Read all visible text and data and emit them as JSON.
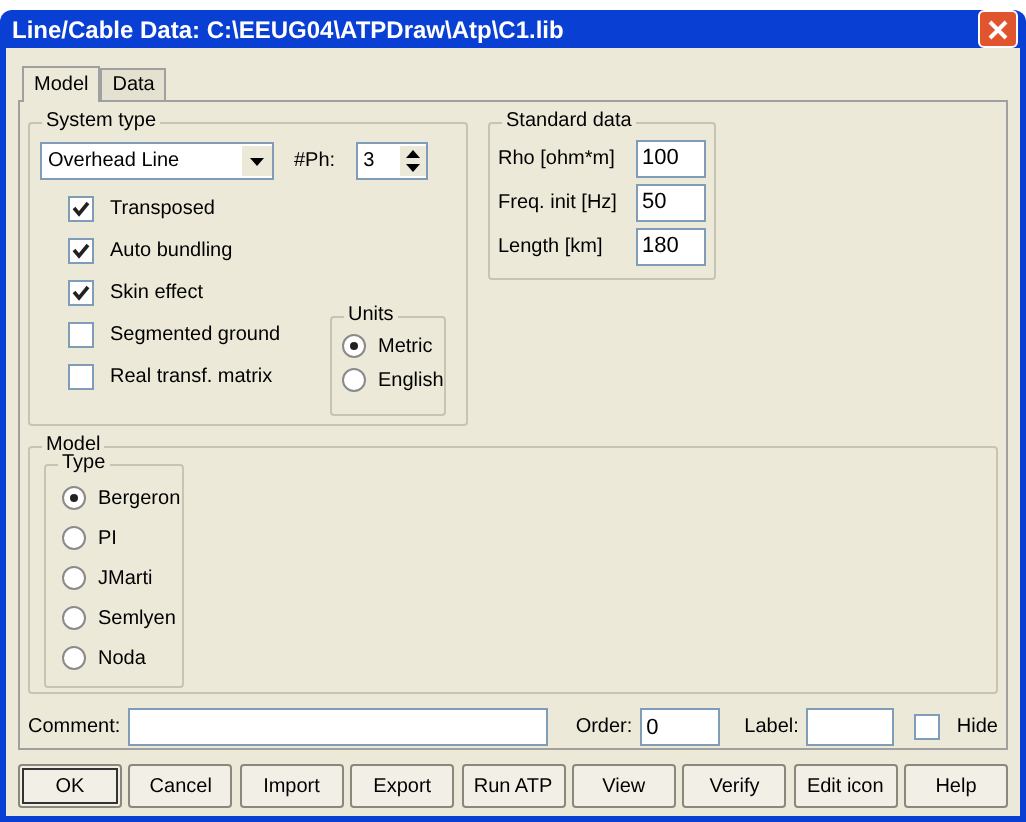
{
  "window": {
    "title": "Line/Cable Data: C:\\EEUG04\\ATPDraw\\Atp\\C1.lib"
  },
  "tabs": [
    {
      "label": "Model",
      "selected": true
    },
    {
      "label": "Data",
      "selected": false
    }
  ],
  "system_type": {
    "title": "System type",
    "dropdown": "Overhead Line",
    "phases_label": "#Ph:",
    "phases": "3",
    "options": [
      {
        "label": "Transposed",
        "checked": true
      },
      {
        "label": "Auto bundling",
        "checked": true
      },
      {
        "label": "Skin effect",
        "checked": true
      },
      {
        "label": "Segmented ground",
        "checked": false
      },
      {
        "label": "Real transf. matrix",
        "checked": false
      }
    ],
    "units": {
      "title": "Units",
      "items": [
        {
          "label": "Metric",
          "selected": true
        },
        {
          "label": "English",
          "selected": false
        }
      ]
    }
  },
  "standard_data": {
    "title": "Standard data",
    "fields": [
      {
        "label": "Rho [ohm*m]",
        "value": "100"
      },
      {
        "label": "Freq. init [Hz]",
        "value": "50"
      },
      {
        "label": "Length [km]",
        "value": "180"
      }
    ]
  },
  "model": {
    "title": "Model",
    "type_title": "Type",
    "types": [
      {
        "label": "Bergeron",
        "selected": true
      },
      {
        "label": "PI",
        "selected": false
      },
      {
        "label": "JMarti",
        "selected": false
      },
      {
        "label": "Semlyen",
        "selected": false
      },
      {
        "label": "Noda",
        "selected": false
      }
    ]
  },
  "comment": {
    "label": "Comment:"
  },
  "order": {
    "label": "Order:",
    "value": "0"
  },
  "label_field": {
    "label": "Label:"
  },
  "hide": {
    "label": "Hide",
    "checked": false
  },
  "buttons": [
    "OK",
    "Cancel",
    "Import",
    "Export",
    "Run ATP",
    "View",
    "Verify",
    "Edit icon",
    "Help"
  ]
}
